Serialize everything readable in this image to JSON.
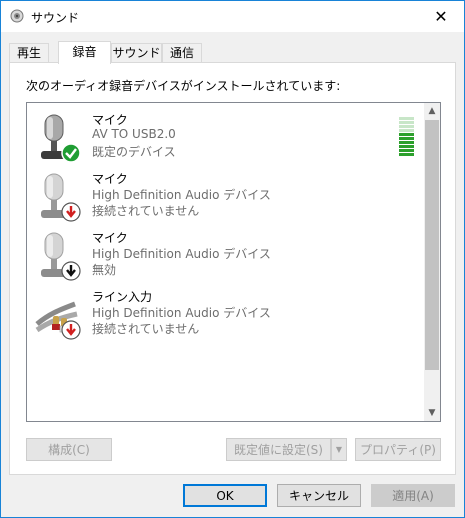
{
  "window": {
    "title": "サウンド",
    "close": "✕"
  },
  "tabs": [
    {
      "label": "再生",
      "active": false
    },
    {
      "label": "録音",
      "active": true
    },
    {
      "label": "サウンド",
      "active": false
    },
    {
      "label": "通信",
      "active": false
    }
  ],
  "panel": {
    "instruction": "次のオーディオ録音デバイスがインストールされています:"
  },
  "devices": [
    {
      "name": "マイク",
      "description": "AV TO USB2.0",
      "status": "既定のデバイス",
      "icon": "microphone-icon",
      "badge": "check-badge-icon"
    },
    {
      "name": "マイク",
      "description": "High Definition Audio デバイス",
      "status": "接続されていません",
      "icon": "microphone-icon",
      "badge": "down-arrow-badge-red-icon"
    },
    {
      "name": "マイク",
      "description": "High Definition Audio デバイス",
      "status": "無効",
      "icon": "microphone-icon",
      "badge": "down-arrow-badge-black-icon"
    },
    {
      "name": "ライン入力",
      "description": "High Definition Audio デバイス",
      "status": "接続されていません",
      "icon": "line-in-cable-icon",
      "badge": "down-arrow-badge-red-icon"
    }
  ],
  "level_meter": {
    "total_segments": 10,
    "active_segments": 6,
    "active_color": "#2ca02c",
    "inactive_color": "#c8e6c8"
  },
  "panel_buttons": {
    "configure": "構成(C)",
    "set_default": "既定値に設定(S)",
    "properties": "プロパティ(P)"
  },
  "dialog_buttons": {
    "ok": "OK",
    "cancel": "キャンセル",
    "apply": "適用(A)"
  }
}
